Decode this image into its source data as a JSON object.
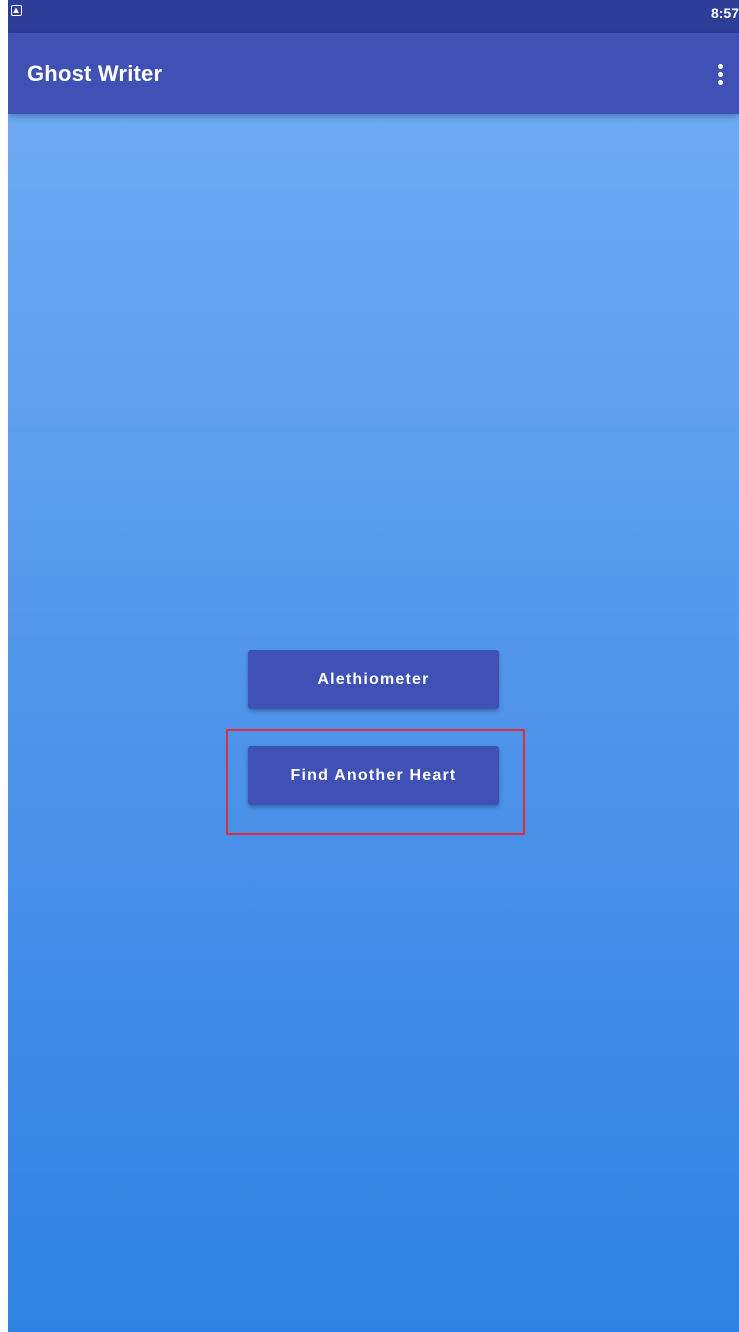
{
  "status_bar": {
    "time": "8:57",
    "notification_icon": "notification-square-icon"
  },
  "app_bar": {
    "title": "Ghost Writer",
    "overflow_icon": "more-vert-icon"
  },
  "main": {
    "buttons": [
      {
        "label": "Alethiometer"
      },
      {
        "label": "Find Another Heart"
      }
    ]
  },
  "colors": {
    "status_bar": "#2e3d97",
    "app_bar": "#3f51b5",
    "button": "#3f51b5",
    "gradient_top": "#6eaaf3",
    "gradient_bottom": "#2f81e3",
    "highlight": "#e02d3a"
  }
}
